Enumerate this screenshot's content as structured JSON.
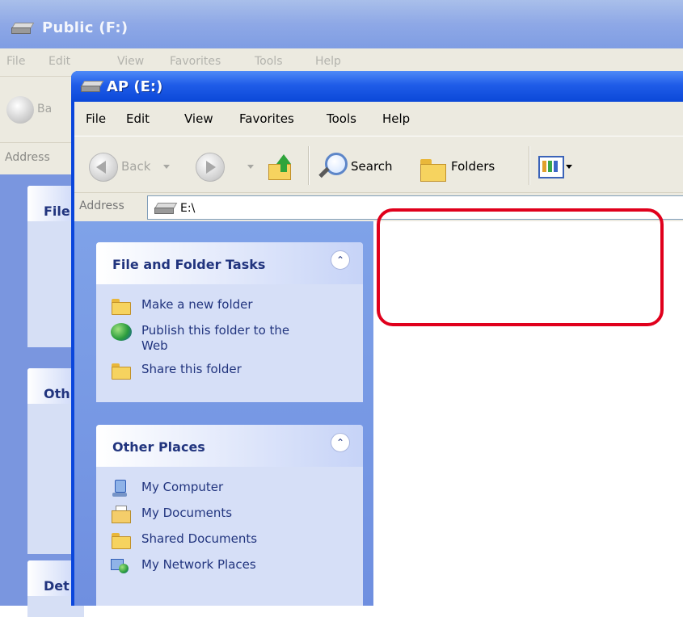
{
  "back_window": {
    "title": "Public (F:)",
    "menu": [
      "File",
      "Edit",
      "View",
      "Favorites",
      "Tools",
      "Help"
    ],
    "back_label": "Ba",
    "address_label": "Address",
    "panel_labels": [
      "File",
      "Oth",
      "Det"
    ]
  },
  "window": {
    "title": "AP (E:)",
    "menu": {
      "file": "File",
      "edit": "Edit",
      "view": "View",
      "favorites": "Favorites",
      "tools": "Tools",
      "help": "Help"
    },
    "toolbar": {
      "back": "Back",
      "search": "Search",
      "folders": "Folders"
    },
    "address": {
      "label": "Address",
      "value": "E:\\"
    }
  },
  "sidebar": {
    "file_tasks": {
      "title": "File and Folder Tasks",
      "items": [
        {
          "label": "Make a new folder",
          "icon": "new-folder-icon"
        },
        {
          "label": "Publish this folder to the Web",
          "icon": "publish-web-icon"
        },
        {
          "label": "Share this folder",
          "icon": "share-folder-icon"
        }
      ]
    },
    "other_places": {
      "title": "Other Places",
      "items": [
        {
          "label": "My Computer",
          "icon": "my-computer-icon"
        },
        {
          "label": "My Documents",
          "icon": "my-documents-icon"
        },
        {
          "label": "Shared Documents",
          "icon": "shared-documents-icon"
        },
        {
          "label": "My Network Places",
          "icon": "network-places-icon"
        }
      ]
    }
  },
  "colors": {
    "title_blue": "#0b48d8",
    "sidebar_blue": "#7a96df",
    "task_text": "#21347e",
    "highlight_red": "#e0001c"
  }
}
